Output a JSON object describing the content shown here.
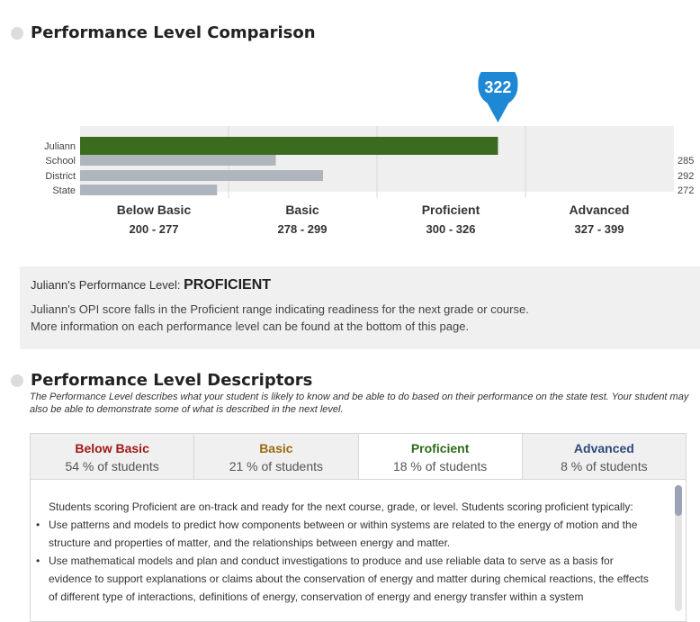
{
  "comparison": {
    "title": "Performance Level Comparison"
  },
  "chart_data": {
    "type": "bar",
    "orientation": "horizontal",
    "xlim": [
      200,
      399
    ],
    "categories": [
      "Juliann",
      "School",
      "District",
      "State"
    ],
    "values": [
      322,
      285,
      292,
      272
    ],
    "value_labels": [
      "322",
      "285",
      "292",
      "272"
    ],
    "highlight_index": 0,
    "colors": {
      "student": "#3a6b1e",
      "comparison": "#aeb5bd",
      "pin": "#1e88d4",
      "band_alt": "#efefef"
    },
    "ranges": [
      {
        "name": "Below Basic",
        "span": "200 - 277",
        "min": 200,
        "max": 277
      },
      {
        "name": "Basic",
        "span": "278 - 299",
        "min": 278,
        "max": 299
      },
      {
        "name": "Proficient",
        "span": "300 - 326",
        "min": 300,
        "max": 326
      },
      {
        "name": "Advanced",
        "span": "327 - 399",
        "min": 327,
        "max": 399
      }
    ]
  },
  "summary": {
    "label": "Juliann's Performance Level: ",
    "level": "PROFICIENT",
    "text1": "Juliann's OPI score falls in the Proficient range indicating readiness for the next grade or course.",
    "text2": "More information on each performance level can be found at the bottom of this page."
  },
  "descriptors": {
    "title": "Performance Level Descriptors",
    "intro": "The Performance Level describes what your student is likely to know and be able to do based on their performance on the state test. Your student may also be able to demonstrate some of what is described in the next level.",
    "tabs": [
      {
        "name": "Below Basic",
        "pct": "54 % of students",
        "color": "#a01818"
      },
      {
        "name": "Basic",
        "pct": "21 % of students",
        "color": "#9a6a10"
      },
      {
        "name": "Proficient",
        "pct": "18 % of students",
        "color": "#2f6b1e"
      },
      {
        "name": "Advanced",
        "pct": "8 % of students",
        "color": "#2d4a7a"
      }
    ],
    "active_tab": 2,
    "panel": {
      "intro": "Students scoring Proficient are on-track and ready for the next course, grade, or level. Students scoring proficient typically:",
      "bullets": [
        "Use patterns and models to predict how components between or within systems are related to the energy of motion and the structure and properties of matter, and the relationships between energy and matter.",
        "Use mathematical models and plan and conduct investigations to produce and use reliable data to serve as a basis for evidence to support explanations or claims about the conservation of energy and matter during chemical reactions, the effects of different type of interactions, definitions of energy, conservation of energy and energy transfer within a system"
      ]
    }
  }
}
